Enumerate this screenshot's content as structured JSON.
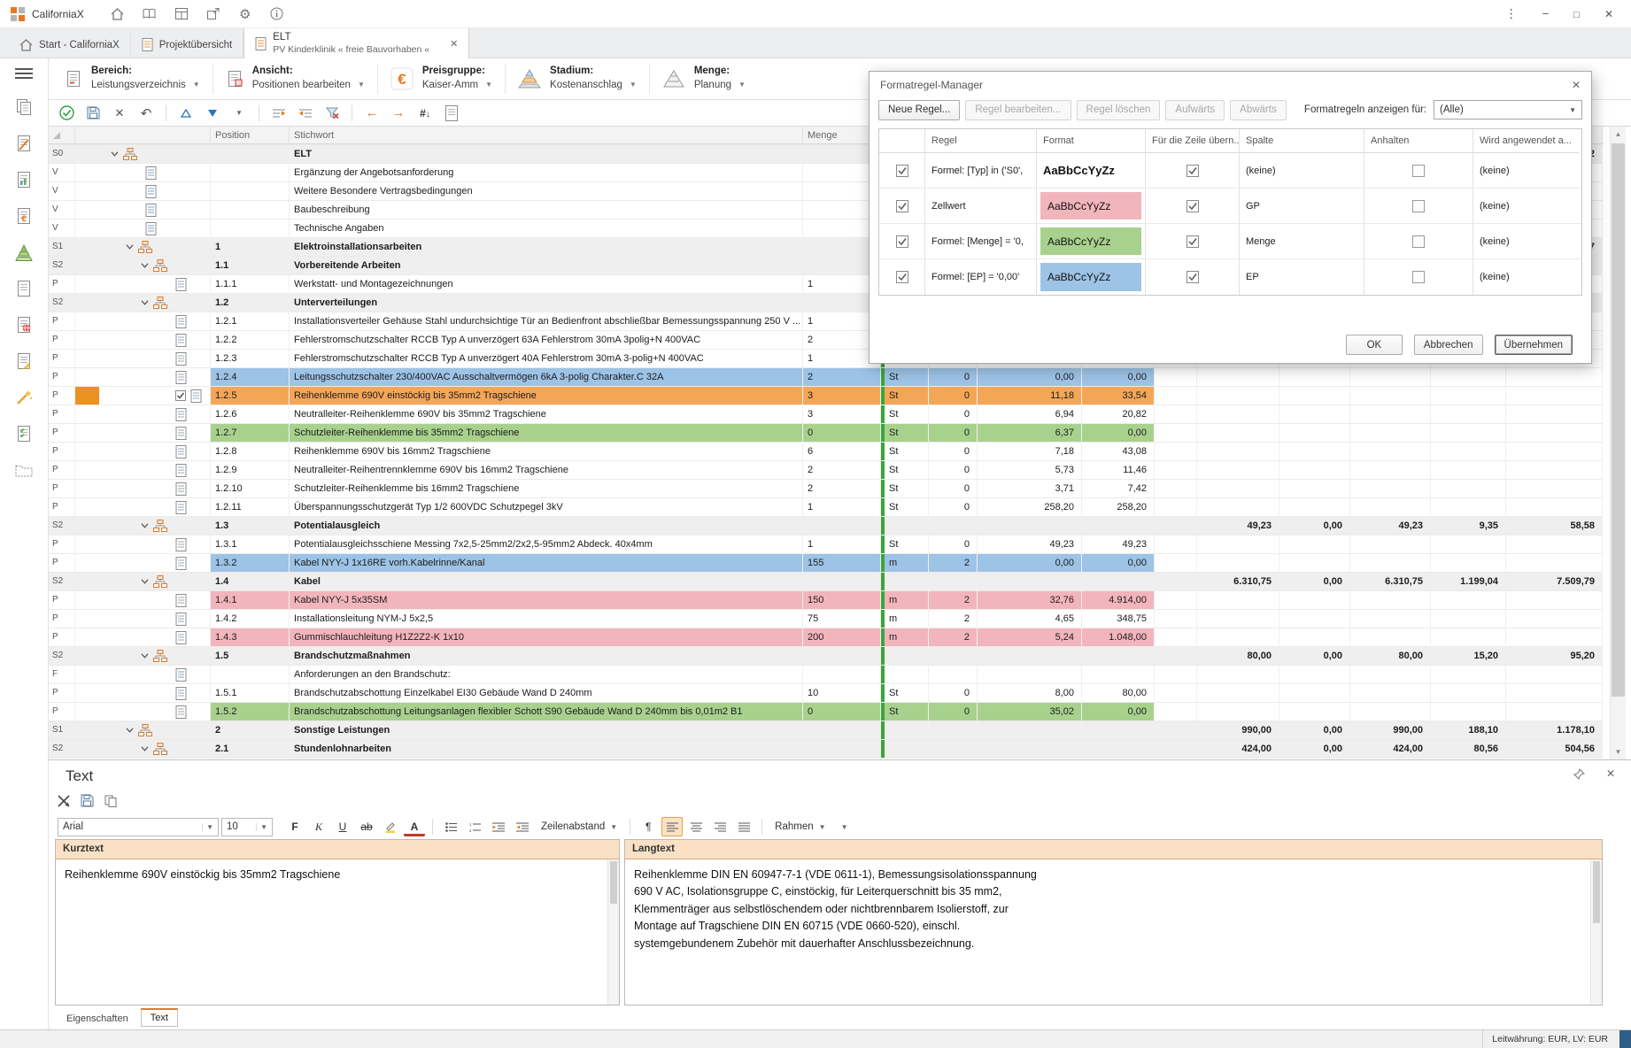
{
  "colors": {
    "row_blue": "#9dc3e6",
    "row_green": "#a9d18e",
    "row_pink": "#f2b5bc",
    "row_orange": "#f4a657",
    "row_orange_handle": "#ec9220",
    "accent_orange": "#e87722",
    "green_divider": "#3aa63a",
    "section_gray": "#efefef"
  },
  "titlebar": {
    "app": "CaliforniaX",
    "icons": [
      "home-icon",
      "book-icon",
      "grid-icon",
      "share-icon",
      "gear-icon",
      "info-icon"
    ],
    "window_controls": [
      "menu-dots-icon",
      "minimize-icon",
      "maximize-icon",
      "close-icon"
    ]
  },
  "window_tabs": [
    {
      "label": "Start - CaliforniaX",
      "icon": "home-icon"
    },
    {
      "label": "Projektübersicht",
      "icon": "list-tab-icon"
    },
    {
      "title": "ELT",
      "subtitle": "PV Kinderklinik « freie Bauvorhaben «",
      "icon": "elt-tab-icon",
      "closable": true
    }
  ],
  "ribbon": [
    {
      "label": "Bereich:",
      "value": "Leistungsverzeichnis",
      "icon": "lv-doc-icon"
    },
    {
      "label": "Ansicht:",
      "value": "Positionen bearbeiten",
      "icon": "view-doc-icon"
    },
    {
      "label": "Preisgruppe:",
      "value": "Kaiser-Amm",
      "icon": "euro-icon"
    },
    {
      "label": "Stadium:",
      "value": "Kostenanschlag",
      "icon": "stadium-icon"
    },
    {
      "label": "Menge:",
      "value": "Planung",
      "icon": "menge-pyramid-icon"
    }
  ],
  "toolbar2": [
    "commit-check-icon",
    "save-icon",
    "cancel-x-icon",
    "undo-icon",
    "sep",
    "sort-asc-icon",
    "sort-desc-icon",
    "dropdown-caret-icon",
    "sep",
    "level-promote-icon",
    "level-demote-icon",
    "filter-remove-icon",
    "sep",
    "nav-back-icon",
    "nav-forward-icon",
    "goto-number-icon",
    "page-preview-icon"
  ],
  "sidebar": {
    "icons": [
      "copy-doc-icon",
      "edit-doc-icon",
      "diagram-doc-icon",
      "euro-doc-icon",
      "pyramid-green-icon",
      "list-doc-icon",
      "globe-doc-icon",
      "note-doc-icon",
      "wand-icon",
      "checklist-icon",
      "folder-icon"
    ]
  },
  "table": {
    "headers": {
      "position": "Position",
      "stichwort": "Stichwort",
      "menge": "Menge"
    },
    "rows": [
      {
        "type": "S0",
        "level": 0,
        "chevron": true,
        "icons": [
          "org-icon"
        ],
        "pos": "",
        "text": "ELT",
        "section": true,
        "sums": [
          "",
          "",
          "",
          "",
          "2"
        ]
      },
      {
        "type": "V",
        "level": 1,
        "icons": [
          "doc-v-icon"
        ],
        "pos": "",
        "text": "Ergänzung der Angebotsanforderung"
      },
      {
        "type": "V",
        "level": 1,
        "icons": [
          "doc-v-icon"
        ],
        "pos": "",
        "text": "Weitere Besondere Vertragsbedingungen"
      },
      {
        "type": "V",
        "level": 1,
        "icons": [
          "doc-v-icon"
        ],
        "pos": "",
        "text": "Baubeschreibung"
      },
      {
        "type": "V",
        "level": 1,
        "icons": [
          "doc-v-icon"
        ],
        "pos": "",
        "text": "Technische Angaben"
      },
      {
        "type": "S1",
        "level": 1,
        "chevron": true,
        "icons": [
          "org-icon"
        ],
        "pos": "1",
        "text": "Elektroinstallationsarbeiten",
        "section": true,
        "sums": [
          "",
          "",
          "",
          "",
          "7"
        ]
      },
      {
        "type": "S2",
        "level": 2,
        "chevron": true,
        "icons": [
          "org-icon"
        ],
        "pos": "1.1",
        "text": "Vorbereitende Arbeiten",
        "section": true
      },
      {
        "type": "P",
        "level": 3,
        "icons": [
          "doc-p-icon"
        ],
        "pos": "1.1.1",
        "text": "Werkstatt- und Montagezeichnungen",
        "menge": "1"
      },
      {
        "type": "S2",
        "level": 2,
        "chevron": true,
        "icons": [
          "org-icon"
        ],
        "pos": "1.2",
        "text": "Unterverteilungen",
        "section": true
      },
      {
        "type": "P",
        "level": 3,
        "icons": [
          "doc-p-icon"
        ],
        "pos": "1.2.1",
        "text": "Installationsverteiler Gehäuse Stahl undurchsichtige Tür an Bedienfront abschließbar Bemessungsspannung 250 V ...",
        "menge": "1"
      },
      {
        "type": "P",
        "level": 3,
        "icons": [
          "doc-p-icon"
        ],
        "pos": "1.2.2",
        "text": "Fehlerstromschutzschalter RCCB Typ A unverzögert 63A Fehlerstrom 30mA 3polig+N 400VAC",
        "menge": "2"
      },
      {
        "type": "P",
        "level": 3,
        "icons": [
          "doc-p-icon"
        ],
        "pos": "1.2.3",
        "text": "Fehlerstromschutzschalter RCCB Typ A unverzögert 40A Fehlerstrom 30mA 3-polig+N 400VAC",
        "menge": "1"
      },
      {
        "type": "P",
        "level": 3,
        "icons": [
          "doc-p-icon"
        ],
        "pos": "1.2.4",
        "text": "Leitungsschutzschalter 230/400VAC Ausschaltvermögen 6kA 3-polig Charakter.C 32A",
        "menge": "2",
        "unit": "St",
        "dec": "0",
        "ep": "0,00",
        "gp": "0,00",
        "color": "blue"
      },
      {
        "type": "P",
        "level": 3,
        "icons": [
          "checkbox-checked-icon",
          "doc-p-icon"
        ],
        "pos": "1.2.5",
        "text": "Reihenklemme 690V einstöckig bis 35mm2 Tragschiene",
        "menge": "3",
        "unit": "St",
        "dec": "0",
        "ep": "11,18",
        "gp": "33,54",
        "color": "orange",
        "selected": true
      },
      {
        "type": "P",
        "level": 3,
        "icons": [
          "doc-p-icon"
        ],
        "pos": "1.2.6",
        "text": "Neutralleiter-Reihenklemme 690V bis 35mm2 Tragschiene",
        "menge": "3",
        "unit": "St",
        "dec": "0",
        "ep": "6,94",
        "gp": "20,82"
      },
      {
        "type": "P",
        "level": 3,
        "icons": [
          "doc-p-icon"
        ],
        "pos": "1.2.7",
        "text": "Schutzleiter-Reihenklemme bis 35mm2 Tragschiene",
        "menge": "0",
        "unit": "St",
        "dec": "0",
        "ep": "6,37",
        "gp": "0,00",
        "color": "green"
      },
      {
        "type": "P",
        "level": 3,
        "icons": [
          "doc-p-icon"
        ],
        "pos": "1.2.8",
        "text": "Reihenklemme 690V bis 16mm2 Tragschiene",
        "menge": "6",
        "unit": "St",
        "dec": "0",
        "ep": "7,18",
        "gp": "43,08"
      },
      {
        "type": "P",
        "level": 3,
        "icons": [
          "doc-p-icon"
        ],
        "pos": "1.2.9",
        "text": "Neutralleiter-Reihentrennklemme 690V bis 16mm2 Tragschiene",
        "menge": "2",
        "unit": "St",
        "dec": "0",
        "ep": "5,73",
        "gp": "11,46"
      },
      {
        "type": "P",
        "level": 3,
        "icons": [
          "doc-p-icon"
        ],
        "pos": "1.2.10",
        "text": "Schutzleiter-Reihenklemme bis 16mm2 Tragschiene",
        "menge": "2",
        "unit": "St",
        "dec": "0",
        "ep": "3,71",
        "gp": "7,42"
      },
      {
        "type": "P",
        "level": 3,
        "icons": [
          "doc-p-icon"
        ],
        "pos": "1.2.11",
        "text": "Überspannungsschutzgerät Typ 1/2 600VDC Schutzpegel 3kV",
        "menge": "1",
        "unit": "St",
        "dec": "0",
        "ep": "258,20",
        "gp": "258,20"
      },
      {
        "type": "S2",
        "level": 2,
        "chevron": true,
        "icons": [
          "org-icon"
        ],
        "pos": "1.3",
        "text": "Potentialausgleich",
        "section": true,
        "sums": [
          "49,23",
          "0,00",
          "49,23",
          "9,35",
          "58,58"
        ]
      },
      {
        "type": "P",
        "level": 3,
        "icons": [
          "doc-p-icon"
        ],
        "pos": "1.3.1",
        "text": "Potentialausgleichsschiene Messing 7x2,5-25mm2/2x2,5-95mm2 Abdeck. 40x4mm",
        "menge": "1",
        "unit": "St",
        "dec": "0",
        "ep": "49,23",
        "gp": "49,23"
      },
      {
        "type": "P",
        "level": 3,
        "icons": [
          "doc-p-icon"
        ],
        "pos": "1.3.2",
        "text": "Kabel NYY-J 1x16RE vorh.Kabelrinne/Kanal",
        "menge": "155",
        "unit": "m",
        "dec": "2",
        "ep": "0,00",
        "gp": "0,00",
        "color": "blue"
      },
      {
        "type": "S2",
        "level": 2,
        "chevron": true,
        "icons": [
          "org-icon"
        ],
        "pos": "1.4",
        "text": "Kabel",
        "section": true,
        "sums": [
          "6.310,75",
          "0,00",
          "6.310,75",
          "1.199,04",
          "7.509,79"
        ]
      },
      {
        "type": "P",
        "level": 3,
        "icons": [
          "doc-p-icon"
        ],
        "pos": "1.4.1",
        "text": "Kabel NYY-J 5x35SM",
        "menge": "150",
        "unit": "m",
        "dec": "2",
        "ep": "32,76",
        "gp": "4.914,00",
        "color": "pink"
      },
      {
        "type": "P",
        "level": 3,
        "icons": [
          "doc-p-icon"
        ],
        "pos": "1.4.2",
        "text": "Installationsleitung NYM-J 5x2,5",
        "menge": "75",
        "unit": "m",
        "dec": "2",
        "ep": "4,65",
        "gp": "348,75"
      },
      {
        "type": "P",
        "level": 3,
        "icons": [
          "doc-p-icon"
        ],
        "pos": "1.4.3",
        "text": "Gummischlauchleitung H1Z2Z2-K 1x10",
        "menge": "200",
        "unit": "m",
        "dec": "2",
        "ep": "5,24",
        "gp": "1.048,00",
        "color": "pink"
      },
      {
        "type": "S2",
        "level": 2,
        "chevron": true,
        "icons": [
          "org-icon"
        ],
        "pos": "1.5",
        "text": "Brandschutzmaßnahmen",
        "section": true,
        "sums": [
          "80,00",
          "0,00",
          "80,00",
          "15,20",
          "95,20"
        ]
      },
      {
        "type": "F",
        "level": 3,
        "icons": [
          "doc-v-icon"
        ],
        "pos": "",
        "text": "Anforderungen an den Brandschutz:"
      },
      {
        "type": "P",
        "level": 3,
        "icons": [
          "doc-p-icon"
        ],
        "pos": "1.5.1",
        "text": "Brandschutzabschottung Einzelkabel EI30 Gebäude Wand D 240mm",
        "menge": "10",
        "unit": "St",
        "dec": "0",
        "ep": "8,00",
        "gp": "80,00"
      },
      {
        "type": "P",
        "level": 3,
        "icons": [
          "doc-p-icon"
        ],
        "pos": "1.5.2",
        "text": "Brandschutzabschottung Leitungsanlagen flexibler Schott S90 Gebäude Wand D 240mm bis 0,01m2 B1",
        "menge": "0",
        "unit": "St",
        "dec": "0",
        "ep": "35,02",
        "gp": "0,00",
        "color": "green"
      },
      {
        "type": "S1",
        "level": 1,
        "chevron": true,
        "icons": [
          "org-icon"
        ],
        "pos": "2",
        "text": "Sonstige Leistungen",
        "section": true,
        "sums": [
          "990,00",
          "0,00",
          "990,00",
          "188,10",
          "1.178,10"
        ]
      },
      {
        "type": "S2",
        "level": 2,
        "chevron": true,
        "icons": [
          "org-icon"
        ],
        "pos": "2.1",
        "text": "Stundenlohnarbeiten",
        "section": true,
        "sums": [
          "424,00",
          "0,00",
          "424,00",
          "80,56",
          "504,56"
        ]
      }
    ]
  },
  "dialog": {
    "title": "Formatregel-Manager",
    "toolbar": {
      "new": "Neue Regel...",
      "edit": "Regel bearbeiten...",
      "delete": "Regel löschen",
      "up": "Aufwärts",
      "down": "Abwärts",
      "filter_label": "Formatregeln anzeigen für:",
      "filter_value": "(Alle)"
    },
    "grid": {
      "headers": [
        "",
        "Regel",
        "Format",
        "Für die Zeile übern...",
        "Spalte",
        "Anhalten",
        "Wird angewendet a..."
      ],
      "sample": "AaBbCcYyZz",
      "rows": [
        {
          "enabled": true,
          "rule": "Formel: [Typ] in ('S0',",
          "format_style": "bold",
          "row_apply": true,
          "column": "(keine)",
          "stop": false,
          "applied": "(keine)"
        },
        {
          "enabled": true,
          "rule": "Zellwert",
          "format_style": "pink",
          "row_apply": true,
          "column": "GP",
          "stop": false,
          "applied": "(keine)"
        },
        {
          "enabled": true,
          "rule": "Formel: [Menge] = '0,",
          "format_style": "green",
          "row_apply": true,
          "column": "Menge",
          "stop": false,
          "applied": "(keine)"
        },
        {
          "enabled": true,
          "rule": "Formel: [EP] = '0,00'",
          "format_style": "blue",
          "row_apply": true,
          "column": "EP",
          "stop": false,
          "applied": "(keine)"
        }
      ]
    },
    "buttons": {
      "ok": "OK",
      "cancel": "Abbrechen",
      "apply": "Übernehmen"
    }
  },
  "text_panel": {
    "title": "Text",
    "font": "Arial",
    "size": "10",
    "buttons": {
      "bold": "F",
      "italic": "K",
      "underline": "U",
      "strike": "ab",
      "fontcolor": "A",
      "pilcrow": "¶"
    },
    "zeilenabstand_label": "Zeilenabstand",
    "rahmen_label": "Rahmen",
    "kurztext": {
      "header": "Kurztext",
      "content": "Reihenklemme 690V einstöckig bis 35mm2 Tragschiene"
    },
    "langtext": {
      "header": "Langtext",
      "lines": [
        "Reihenklemme DIN EN 60947-7-1 (VDE 0611-1), Bemessungsisolationsspannung",
        "690 V AC, Isolationsgruppe C, einstöckig, für Leiterquerschnitt bis 35 mm2,",
        "Klemmenträger aus selbstlöschendem oder nichtbrennbarem Isolierstoff, zur",
        "Montage auf Tragschiene DIN EN 60715 (VDE 0660-520), einschl.",
        "systemgebundenem Zubehör mit dauerhafter Anschlussbezeichnung."
      ]
    },
    "tabs": [
      "Eigenschaften",
      "Text"
    ],
    "active_tab": "Text"
  },
  "statusbar": {
    "currency": "Leitwährung: EUR, LV: EUR"
  }
}
